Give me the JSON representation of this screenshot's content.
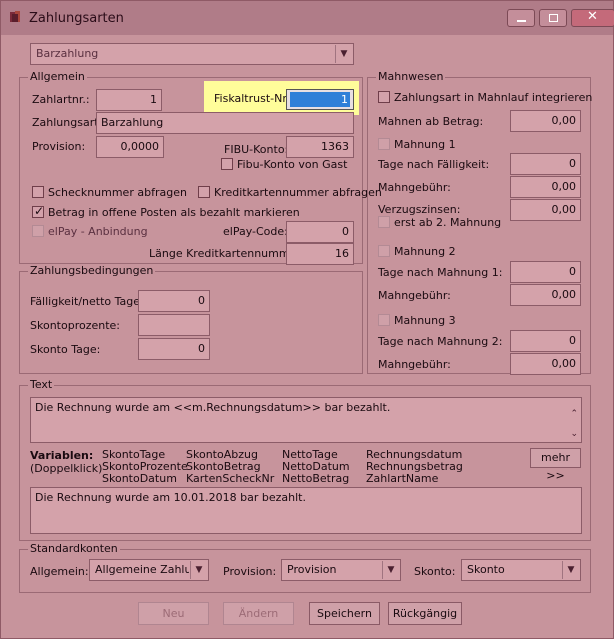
{
  "window": {
    "title": "Zahlungsarten",
    "min_icon": "minimize-icon",
    "max_icon": "maximize-icon",
    "close_icon": "close-icon"
  },
  "top_combo": {
    "value": "Barzahlung"
  },
  "allgemein": {
    "title": "Allgemein",
    "zahlartnr_label": "Zahlartnr.:",
    "zahlartnr_value": "1",
    "fiskaltrust_label": "Fiskaltrust-Nr.:",
    "fiskaltrust_value": "1",
    "zahlungsart_label": "Zahlungsart:",
    "zahlungsart_value": "Barzahlung",
    "provision_label": "Provision:",
    "provision_value": "0,0000",
    "fibu_label": "FIBU-Konto:",
    "fibu_value": "1363",
    "fibu_gast_label": "Fibu-Konto von Gast",
    "scheck_label": "Schecknummer abfragen",
    "kredit_label": "Kreditkartennummer abfragen",
    "betrag_label": "Betrag in offene Posten als bezahlt markieren",
    "elpay_label": "elPay - Anbindung",
    "elpay_code_label": "elPay-Code:",
    "elpay_code_value": "0",
    "laenge_label": "Länge Kreditkartennummer:",
    "laenge_value": "16"
  },
  "zahlungsbedingungen": {
    "title": "Zahlungsbedingungen",
    "faellig_label": "Fälligkeit/netto Tage:",
    "faellig_value": "0",
    "skonto_prozente_label": "Skontoprozente:",
    "skonto_prozente_value": "",
    "skonto_tage_label": "Skonto Tage:",
    "skonto_tage_value": "0"
  },
  "mahnwesen": {
    "title": "Mahnwesen",
    "integrieren_label": "Zahlungsart in Mahnlauf integrieren",
    "mahnen_ab_label": "Mahnen ab Betrag:",
    "mahnen_ab_value": "0,00",
    "mahnung1_label": "Mahnung 1",
    "tage_faellig_label": "Tage nach Fälligkeit:",
    "tage_faellig_value": "0",
    "gebuehr1_label": "Mahngebühr:",
    "gebuehr1_value": "0,00",
    "verzug_label": "Verzugszinsen:",
    "verzug_value": "0,00",
    "erst_ab_label": "erst ab 2. Mahnung",
    "mahnung2_label": "Mahnung 2",
    "tage_m1_label": "Tage nach Mahnung 1:",
    "tage_m1_value": "0",
    "gebuehr2_label": "Mahngebühr:",
    "gebuehr2_value": "0,00",
    "mahnung3_label": "Mahnung 3",
    "tage_m2_label": "Tage nach Mahnung 2:",
    "tage_m2_value": "0",
    "gebuehr3_label": "Mahngebühr:",
    "gebuehr3_value": "0,00"
  },
  "text": {
    "title": "Text",
    "template": "Die Rechnung wurde am <<m.Rechnungsdatum>> bar bezahlt.",
    "variablen_label": "Variablen:",
    "doppelklick_label": "(Doppelklick)",
    "variables": [
      [
        "SkontoTage",
        "SkontoProzente",
        "SkontoDatum"
      ],
      [
        "SkontoAbzug",
        "SkontoBetrag",
        "KartenScheckNr"
      ],
      [
        "NettoTage",
        "NettoDatum",
        "NettoBetrag"
      ],
      [
        "Rechnungsdatum",
        "Rechnungsbetrag",
        "ZahlartName"
      ]
    ],
    "mehr_label": "mehr >>",
    "preview": "Die Rechnung wurde am 10.01.2018 bar bezahlt."
  },
  "standardkonten": {
    "title": "Standardkonten",
    "allgemein_label": "Allgemein:",
    "allgemein_value": "Allgemeine Zahlung",
    "provision_label": "Provision:",
    "provision_value": "Provision",
    "skonto_label": "Skonto:",
    "skonto_value": "Skonto"
  },
  "buttons": {
    "neu": "Neu",
    "aendern": "Ändern",
    "speichern": "Speichern",
    "rueckgaengig": "Rückgängig"
  }
}
